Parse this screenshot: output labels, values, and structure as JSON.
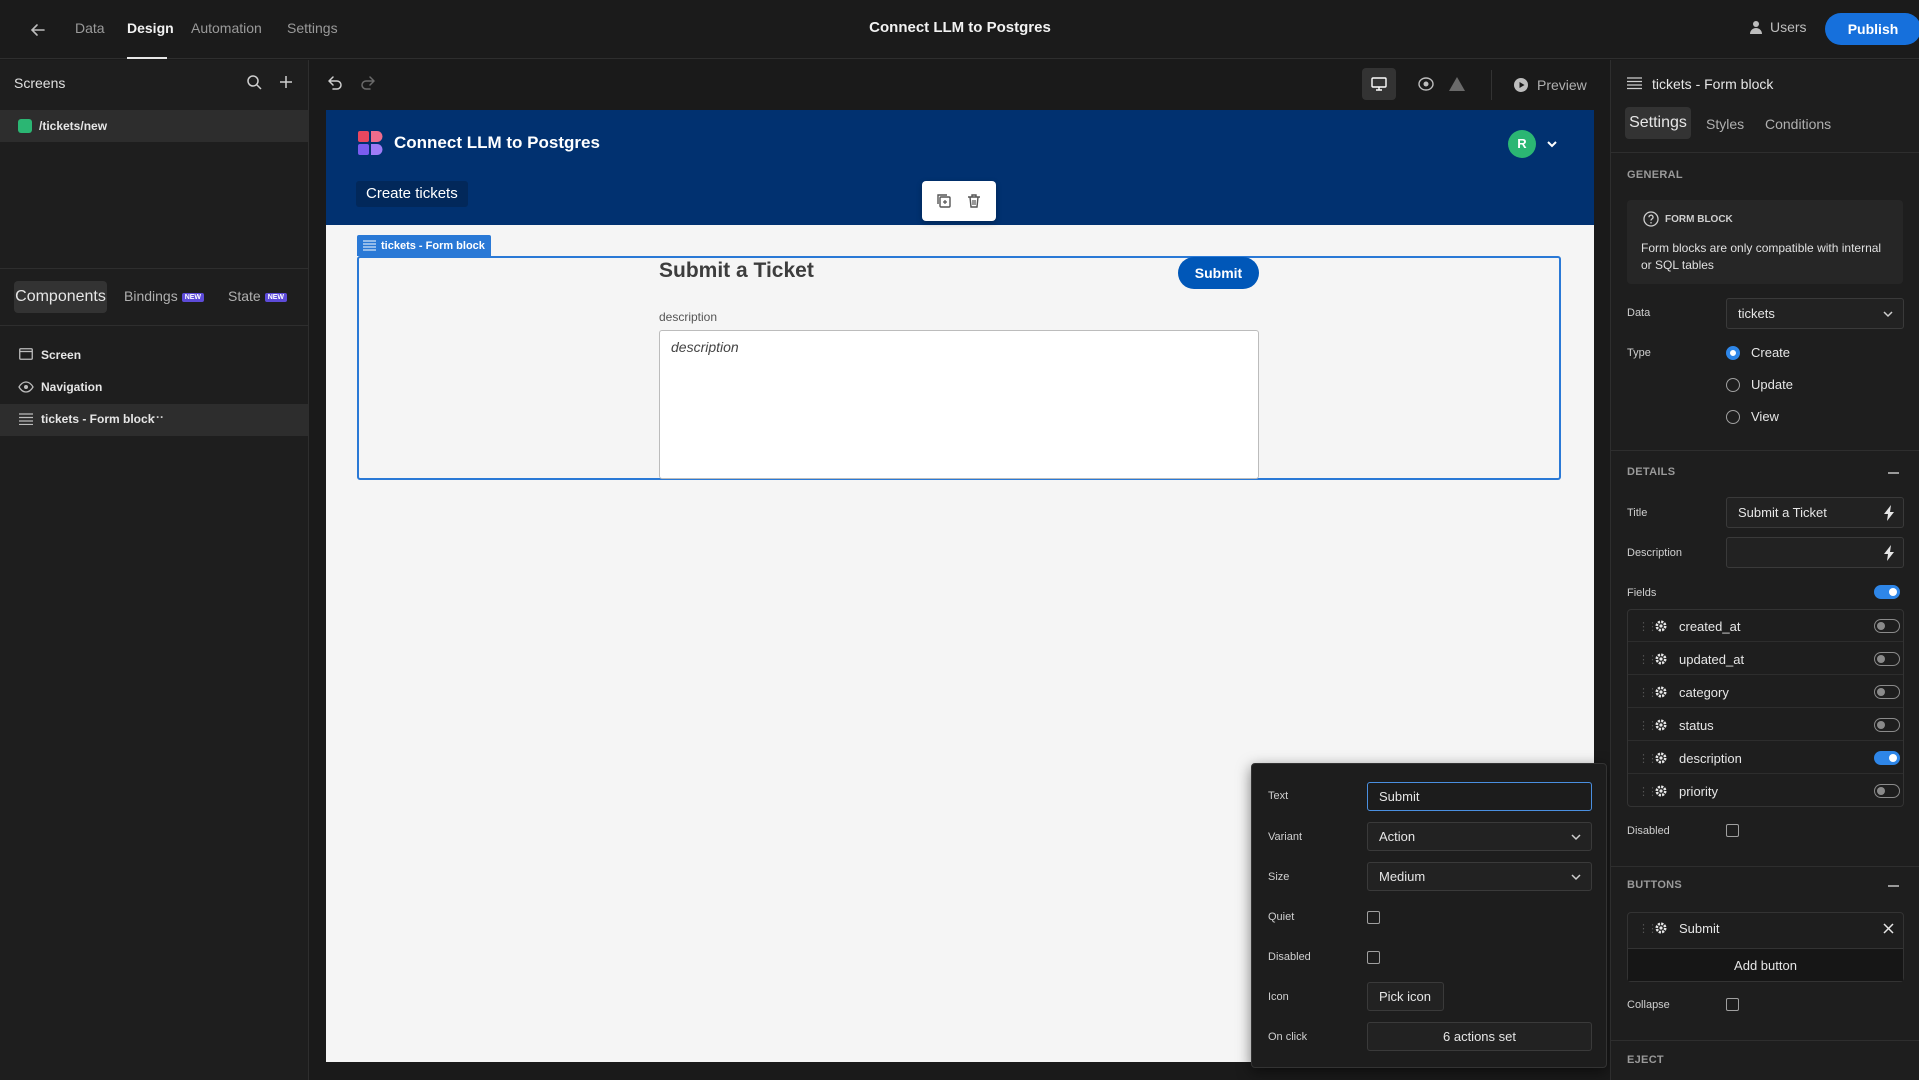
{
  "topbar": {
    "nav": [
      "Data",
      "Design",
      "Automation",
      "Settings"
    ],
    "app_title": "Connect LLM to Postgres",
    "users_label": "Users",
    "publish_label": "Publish"
  },
  "left": {
    "screens_label": "Screens",
    "route": "/tickets/new",
    "tabs": {
      "components": "Components",
      "bindings": "Bindings",
      "state": "State",
      "new_badge": "NEW"
    },
    "tree": [
      "Screen",
      "Navigation",
      "tickets - Form block"
    ],
    "more": "···"
  },
  "canvas": {
    "preview_label": "Preview",
    "app_name": "Connect LLM to Postgres",
    "avatar_letter": "R",
    "nav_link": "Create tickets",
    "block_tag": "tickets - Form block",
    "form_title": "Submit a Ticket",
    "submit_label": "Submit",
    "field_label": "description",
    "field_placeholder": "description"
  },
  "popover": {
    "text_label": "Text",
    "text_value": "Submit",
    "variant_label": "Variant",
    "variant_value": "Action",
    "size_label": "Size",
    "size_value": "Medium",
    "quiet_label": "Quiet",
    "disabled_label": "Disabled",
    "icon_label": "Icon",
    "icon_button": "Pick icon",
    "onclick_label": "On click",
    "onclick_value": "6 actions set"
  },
  "right": {
    "title": "tickets - Form block",
    "tabs": [
      "Settings",
      "Styles",
      "Conditions"
    ],
    "general_head": "GENERAL",
    "info_head": "FORM BLOCK",
    "info_text": "Form blocks are only compatible with internal or SQL tables",
    "data_label": "Data",
    "data_value": "tickets",
    "type_label": "Type",
    "type_options": [
      "Create",
      "Update",
      "View"
    ],
    "type_selected": "Create",
    "details_head": "DETAILS",
    "title_label": "Title",
    "title_value": "Submit a Ticket",
    "description_label": "Description",
    "description_value": "",
    "fields_label": "Fields",
    "fields": [
      {
        "name": "created_at",
        "on": false
      },
      {
        "name": "updated_at",
        "on": false
      },
      {
        "name": "category",
        "on": false
      },
      {
        "name": "status",
        "on": false
      },
      {
        "name": "description",
        "on": true
      },
      {
        "name": "priority",
        "on": false
      }
    ],
    "disabled_label": "Disabled",
    "buttons_head": "BUTTONS",
    "button_item": "Submit",
    "add_button": "Add button",
    "collapse_label": "Collapse",
    "eject_head": "EJECT"
  },
  "colors": {
    "accent": "#1670dc",
    "app_header": "#013170",
    "selection": "#2a79d6"
  }
}
